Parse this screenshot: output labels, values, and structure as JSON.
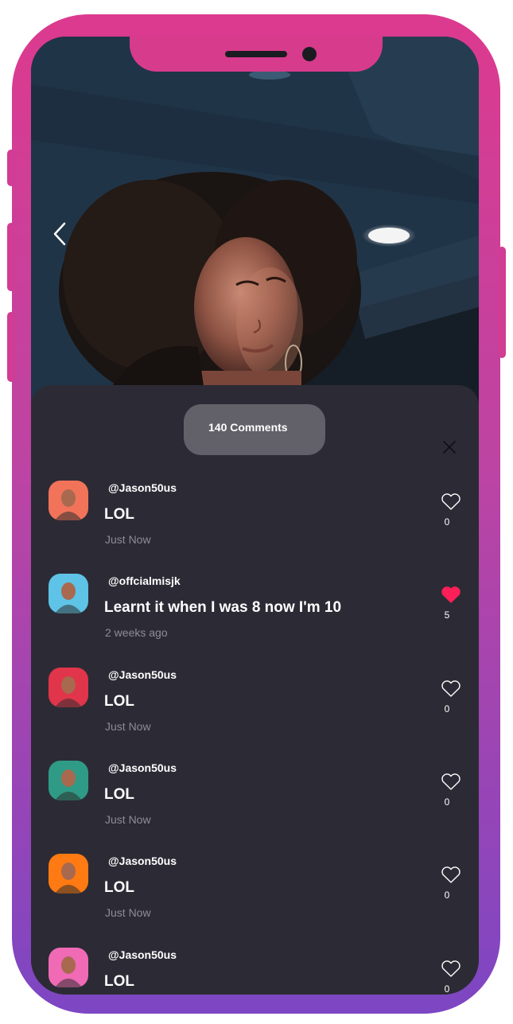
{
  "device": {
    "frame_gradient": [
      "#dc3a8e",
      "#7d46c3"
    ]
  },
  "photo": {
    "back_icon": "chevron-left-icon"
  },
  "comments_sheet": {
    "count_label": "140 Comments",
    "close_icon": "close-icon",
    "like_color": "#ff1f58"
  },
  "comments": [
    {
      "username": "@Jason50us",
      "text": "LOL",
      "time": "Just Now",
      "likes": "0",
      "liked": false,
      "avatar_color": "#f1735a"
    },
    {
      "username": "@offcialmisjk",
      "text": "Learnt it when I was 8 now I'm 10",
      "time": "2 weeks ago",
      "likes": "5",
      "liked": true,
      "avatar_color": "#5ec3e6"
    },
    {
      "username": "@Jason50us",
      "text": "LOL",
      "time": "Just Now",
      "likes": "0",
      "liked": false,
      "avatar_color": "#e0354a"
    },
    {
      "username": "@Jason50us",
      "text": "LOL",
      "time": "Just Now",
      "likes": "0",
      "liked": false,
      "avatar_color": "#2f9b86"
    },
    {
      "username": "@Jason50us",
      "text": "LOL",
      "time": "Just Now",
      "likes": "0",
      "liked": false,
      "avatar_color": "#ff7a12"
    },
    {
      "username": "@Jason50us",
      "text": "LOL",
      "time": "",
      "likes": "0",
      "liked": false,
      "avatar_color": "#f06ab5"
    }
  ]
}
